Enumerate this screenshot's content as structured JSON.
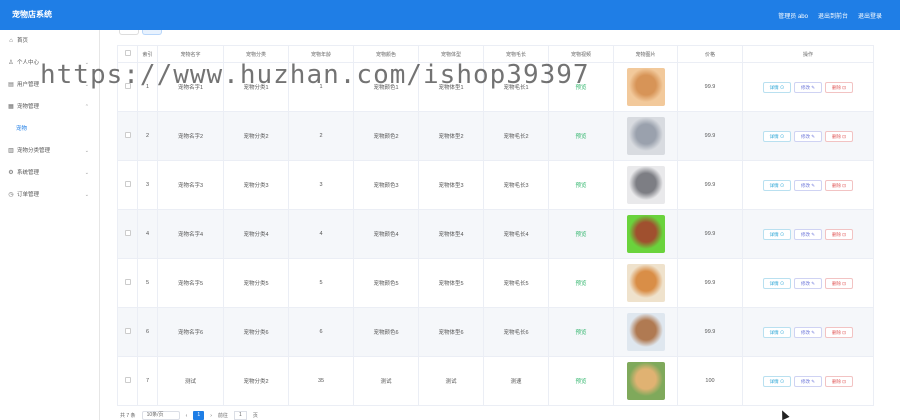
{
  "app": {
    "title": "宠物店系统"
  },
  "topbar": {
    "admin": "管理员 abo",
    "back_front": "退出到前台",
    "logout": "退出登录"
  },
  "sidebar": {
    "items": [
      {
        "label": "首页",
        "icon": "home-icon",
        "arrow": ""
      },
      {
        "label": "个人中心",
        "icon": "user-icon",
        "arrow": "⌄"
      },
      {
        "label": "用户管理",
        "icon": "users-icon",
        "arrow": "⌄"
      },
      {
        "label": "宠物管理",
        "icon": "pet-icon",
        "arrow": "⌃"
      },
      {
        "label": "宠物",
        "icon": "",
        "arrow": "",
        "sub": true
      },
      {
        "label": "宠物分类管理",
        "icon": "grid-icon",
        "arrow": "⌄"
      },
      {
        "label": "系统管理",
        "icon": "gear-icon",
        "arrow": "⌄"
      },
      {
        "label": "订单管理",
        "icon": "clock-icon",
        "arrow": "⌄"
      }
    ]
  },
  "table": {
    "headers": [
      "",
      "索引",
      "宠物名字",
      "宠物分类",
      "宠物年龄",
      "宠物颜色",
      "宠物体型",
      "宠物毛长",
      "宠物视频",
      "宠物图片",
      "价格",
      "操作"
    ],
    "rows": [
      {
        "idx": "1",
        "name": "宠物名字1",
        "cat": "宠物分类1",
        "age": "1",
        "color": "宠物颜色1",
        "size": "宠物体型1",
        "hair": "宠物毛长1",
        "video": "预览",
        "photo": "cat",
        "price": "99.9"
      },
      {
        "idx": "2",
        "name": "宠物名字2",
        "cat": "宠物分类2",
        "age": "2",
        "color": "宠物颜色2",
        "size": "宠物体型2",
        "hair": "宠物毛长2",
        "video": "预览",
        "photo": "gray-cat",
        "price": "99.9"
      },
      {
        "idx": "3",
        "name": "宠物名字3",
        "cat": "宠物分类3",
        "age": "3",
        "color": "宠物颜色3",
        "size": "宠物体型3",
        "hair": "宠物毛长3",
        "video": "预览",
        "photo": "husky",
        "price": "99.9"
      },
      {
        "idx": "4",
        "name": "宠物名字4",
        "cat": "宠物分类4",
        "age": "4",
        "color": "宠物颜色4",
        "size": "宠物体型4",
        "hair": "宠物毛长4",
        "video": "预览",
        "photo": "poodle",
        "price": "99.9"
      },
      {
        "idx": "5",
        "name": "宠物名字5",
        "cat": "宠物分类5",
        "age": "5",
        "color": "宠物颜色5",
        "size": "宠物体型5",
        "hair": "宠物毛长5",
        "video": "预览",
        "photo": "shiba",
        "price": "99.9"
      },
      {
        "idx": "6",
        "name": "宠物名字6",
        "cat": "宠物分类6",
        "age": "6",
        "color": "宠物颜色6",
        "size": "宠物体型6",
        "hair": "宠物毛长6",
        "video": "预览",
        "photo": "dog-snow",
        "price": "99.9"
      },
      {
        "idx": "7",
        "name": "测试",
        "cat": "宠物分类2",
        "age": "35",
        "color": "测试",
        "size": "测试",
        "hair": "测速",
        "video": "预览",
        "photo": "golden",
        "price": "100"
      }
    ],
    "ops": {
      "detail": "详情 ⊙",
      "edit": "修改 ✎",
      "delete": "删除 ⊡"
    }
  },
  "pager": {
    "total": "共 7 条",
    "size": "10条/页",
    "prev": "‹",
    "current": "1",
    "next": "›",
    "goto": "前往",
    "goto_val": "1",
    "page_unit": "页"
  },
  "watermark": "https://www.huzhan.com/ishop39397",
  "colors": {
    "primary": "#1f7ee6",
    "success": "#2fb56b",
    "danger": "#e05858"
  },
  "photo_colors": {
    "cat": [
      "#d79457",
      "#f2c99b"
    ],
    "gray-cat": [
      "#9aa1ad",
      "#d8dbe0"
    ],
    "husky": [
      "#7d7e84",
      "#e9e9eb"
    ],
    "poodle": [
      "#a0502f",
      "#6ad33c"
    ],
    "shiba": [
      "#d98e47",
      "#efe2cc"
    ],
    "dog-snow": [
      "#b07a52",
      "#dfe7ef"
    ],
    "golden": [
      "#e0b272",
      "#7fa95b"
    ]
  }
}
